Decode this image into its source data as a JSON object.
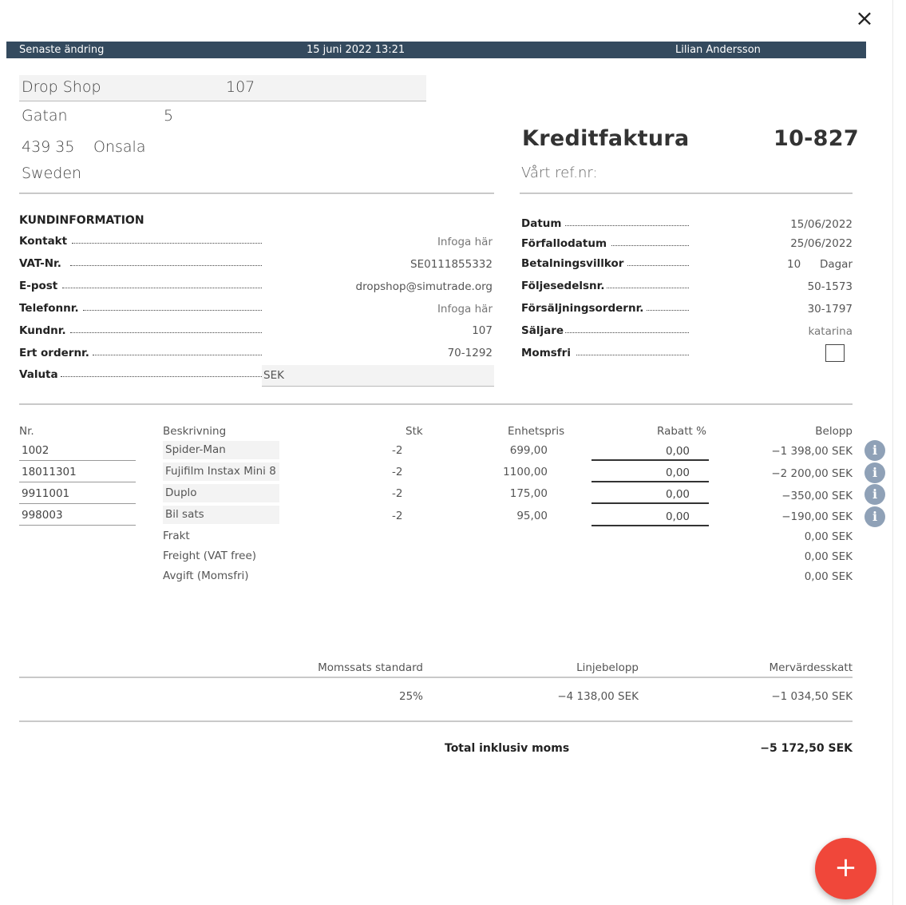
{
  "close_icon": "×",
  "header": {
    "label": "Senaste ändring",
    "datetime": "15 juni 2022 13:21",
    "user": "Lilian Andersson"
  },
  "customer": {
    "name": "Drop Shop",
    "number": "107",
    "street": "Gatan",
    "street_no": "5",
    "zip": "439 35",
    "city": "Onsala",
    "country": "Sweden"
  },
  "invoice": {
    "title": "Kreditfaktura",
    "number": "10-827",
    "ref_placeholder": "Vårt ref.nr:"
  },
  "customer_info": {
    "section_title": "KUNDINFORMATION",
    "rows": [
      {
        "label": "Kontakt",
        "value": "Infoga här"
      },
      {
        "label": "VAT-Nr.",
        "value": "SE0111855332"
      },
      {
        "label": "E-post",
        "value": "dropshop@simutrade.org"
      },
      {
        "label": "Telefonnr.",
        "value": "Infoga här"
      },
      {
        "label": "Kundnr.",
        "value": "107"
      },
      {
        "label": "Ert ordernr.",
        "value": "70-1292"
      },
      {
        "label": "Valuta",
        "value": "SEK"
      }
    ]
  },
  "invoice_info": {
    "rows": [
      {
        "label": "Datum",
        "value": "15/06/2022"
      },
      {
        "label": "Förfallodatum",
        "value": "25/06/2022"
      },
      {
        "label": "Betalningsvillkor",
        "value": "10",
        "unit": "Dagar"
      },
      {
        "label": "Följesedelsnr.",
        "value": "50-1573"
      },
      {
        "label": "Försäljningsordernr.",
        "value": "30-1797"
      },
      {
        "label": "Säljare",
        "value": "katarina"
      },
      {
        "label": "Momsfri",
        "value": ""
      }
    ]
  },
  "lines": {
    "headers": {
      "nr": "Nr.",
      "desc": "Beskrivning",
      "qty": "Stk",
      "price": "Enhetspris",
      "discount": "Rabatt %",
      "amount": "Belopp"
    },
    "rows": [
      {
        "nr": "1002",
        "desc": "Spider-Man",
        "qty": "-2",
        "price": "699,00",
        "discount": "0,00",
        "amount": "−1 398,00 SEK"
      },
      {
        "nr": "18011301",
        "desc": "Fujifilm Instax Mini 8",
        "qty": "-2",
        "price": "1100,00",
        "discount": "0,00",
        "amount": "−2 200,00 SEK"
      },
      {
        "nr": "9911001",
        "desc": "Duplo",
        "qty": "-2",
        "price": "175,00",
        "discount": "0,00",
        "amount": "−350,00 SEK"
      },
      {
        "nr": "998003",
        "desc": "Bil sats",
        "qty": "-2",
        "price": "95,00",
        "discount": "0,00",
        "amount": "−190,00 SEK"
      }
    ],
    "extras": [
      {
        "desc": "Frakt",
        "amount": "0,00 SEK"
      },
      {
        "desc": "Freight (VAT free)",
        "amount": "0,00 SEK"
      },
      {
        "desc": "Avgift (Momsfri)",
        "amount": "0,00 SEK"
      }
    ],
    "info_icon": "i"
  },
  "vat": {
    "headers": {
      "rate": "Momssats standard",
      "line_amount": "Linjebelopp",
      "vat": "Mervärdesskatt"
    },
    "row": {
      "rate": "25%",
      "line_amount": "−4 138,00 SEK",
      "vat": "−1 034,50 SEK"
    }
  },
  "total": {
    "label": "Total inklusiv moms",
    "value": "−5 172,50 SEK"
  },
  "fab_icon": "+"
}
